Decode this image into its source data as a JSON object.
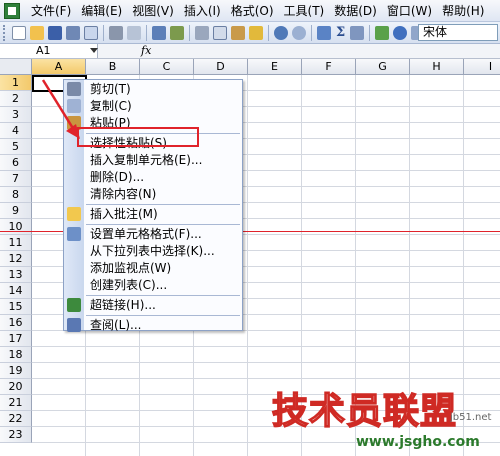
{
  "menubar": {
    "items": [
      "文件(F)",
      "编辑(E)",
      "视图(V)",
      "插入(I)",
      "格式(O)",
      "工具(T)",
      "数据(D)",
      "窗口(W)",
      "帮助(H)"
    ]
  },
  "toolbar": {
    "font_name": "宋体"
  },
  "formula_bar": {
    "name_box": "A1",
    "fx_label": "fx"
  },
  "grid": {
    "columns": [
      "A",
      "B",
      "C",
      "D",
      "E",
      "F",
      "G",
      "H",
      "I"
    ],
    "rows": [
      "1",
      "2",
      "3",
      "4",
      "5",
      "6",
      "7",
      "8",
      "9",
      "10",
      "11",
      "12",
      "13",
      "14",
      "15",
      "16",
      "17",
      "18",
      "19",
      "20",
      "21",
      "22",
      "23"
    ],
    "active_cell": "A1"
  },
  "context_menu": {
    "items": [
      {
        "label": "剪切(T)",
        "icon": "scissors-icon"
      },
      {
        "label": "复制(C)",
        "icon": "copy-icon"
      },
      {
        "label": "粘贴(P)",
        "icon": "paste-icon"
      },
      {
        "label": "选择性粘贴(S)...",
        "icon": ""
      },
      {
        "label": "插入复制单元格(E)...",
        "icon": ""
      },
      {
        "label": "删除(D)...",
        "icon": ""
      },
      {
        "label": "清除内容(N)",
        "icon": ""
      },
      {
        "label": "插入批注(M)",
        "icon": "comment-icon"
      },
      {
        "label": "设置单元格格式(F)...",
        "icon": "format-cells-icon"
      },
      {
        "label": "从下拉列表中选择(K)...",
        "icon": ""
      },
      {
        "label": "添加监视点(W)",
        "icon": ""
      },
      {
        "label": "创建列表(C)...",
        "icon": ""
      },
      {
        "label": "超链接(H)...",
        "icon": "hyperlink-icon"
      },
      {
        "label": "查阅(L)...",
        "icon": "lookup-icon"
      }
    ]
  },
  "watermark": {
    "title": "技术员联盟",
    "sub": "jb51.net",
    "url": "www.jsgho.com"
  },
  "colors": {
    "highlight_red": "#e0232b"
  }
}
